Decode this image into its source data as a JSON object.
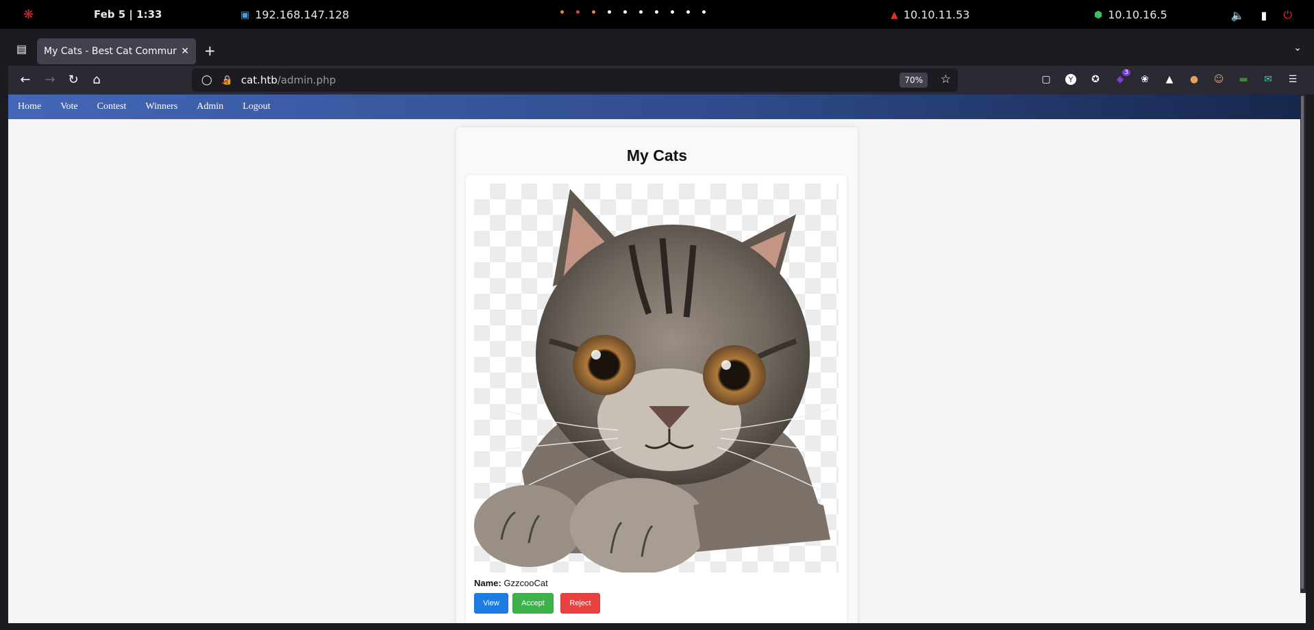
{
  "system_bar": {
    "datetime": "Feb 5 | 1:33",
    "ip_local": "192.168.147.128",
    "ip_target": "10.10.11.53",
    "ip_vpn": "10.10.16.5"
  },
  "browser": {
    "tab_title": "My Cats - Best Cat Community",
    "url_host": "cat.htb",
    "url_path": "/admin.php",
    "zoom": "70%",
    "extension_badge": "3"
  },
  "site_nav": [
    "Home",
    "Vote",
    "Contest",
    "Winners",
    "Admin",
    "Logout"
  ],
  "page": {
    "title": "My Cats",
    "cat": {
      "name_label": "Name:",
      "name_value": "GzzcooCat"
    },
    "buttons": {
      "view": "View",
      "accept": "Accept",
      "reject": "Reject"
    }
  },
  "colors": {
    "nav_gradient_start": "#4466b6",
    "nav_gradient_end": "#17264b",
    "view_button": "#1e7be4",
    "accept_button": "#3cb14c",
    "reject_button": "#e94040"
  }
}
